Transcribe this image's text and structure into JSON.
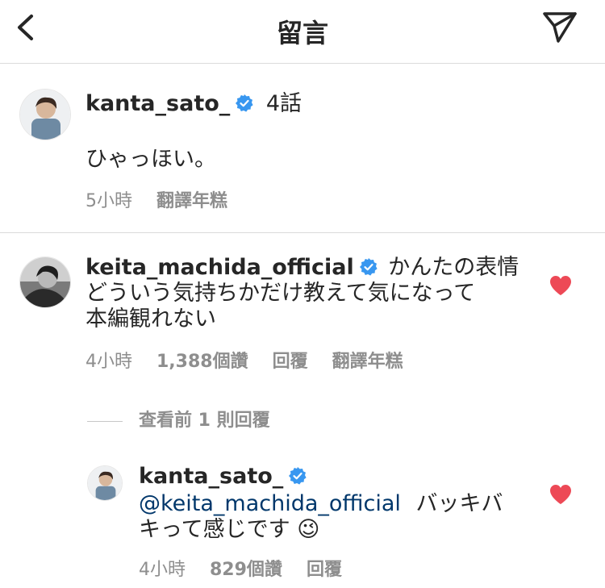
{
  "header": {
    "title": "留言",
    "back_icon": "chevron-left-icon",
    "send_icon": "paper-plane-icon"
  },
  "caption": {
    "username": "kanta_sato_",
    "episode": "4話",
    "text": "ひゃっほい。",
    "time": "5小時",
    "translate": "翻譯年糕"
  },
  "comment": {
    "username": "keita_machida_official",
    "text_line1": "かんたの表情",
    "text_line2": "どういう気持ちかだけ教えて気になって",
    "text_line3": "本編観れない",
    "time": "4小時",
    "likes": "1,388個讚",
    "reply": "回覆",
    "translate": "翻譯年糕",
    "liked": true
  },
  "view_replies": "查看前 1 則回覆",
  "reply": {
    "username": "kanta_sato_",
    "mention": "@keita_machida_official",
    "text_line1": "バッキバ",
    "text_line2": "キって感じです",
    "emoji": "😉",
    "time": "4小時",
    "likes": "829個讚",
    "reply": "回覆",
    "liked": true
  },
  "colors": {
    "heart": "#ed4956",
    "verified": "#3897f0",
    "mention": "#00376b",
    "meta": "#8e8e8e"
  }
}
